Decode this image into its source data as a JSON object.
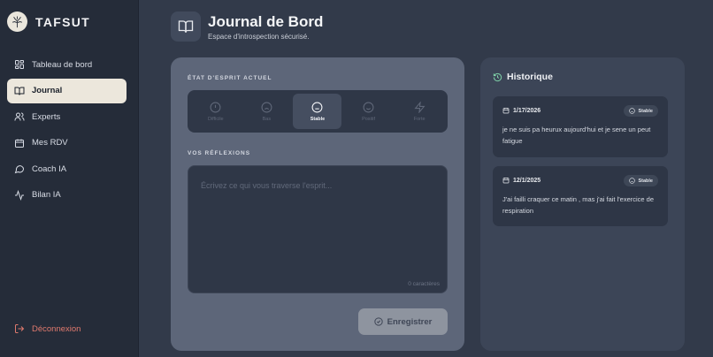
{
  "brand": {
    "name": "TAFSUT",
    "logo_icon": "tree-icon"
  },
  "sidebar": {
    "items": [
      {
        "label": "Tableau de bord",
        "icon": "dashboard-grid-icon",
        "active": false
      },
      {
        "label": "Journal",
        "icon": "book-icon",
        "active": true
      },
      {
        "label": "Experts",
        "icon": "users-icon",
        "active": false
      },
      {
        "label": "Mes RDV",
        "icon": "calendar-icon",
        "active": false
      },
      {
        "label": "Coach IA",
        "icon": "chat-bubble-icon",
        "active": false
      },
      {
        "label": "Bilan IA",
        "icon": "activity-icon",
        "active": false
      }
    ],
    "logout_label": "Déconnexion"
  },
  "header": {
    "title": "Journal de Bord",
    "subtitle": "Espace d'introspection sécurisé."
  },
  "mood_section": {
    "label": "ÉTAT D'ESPRIT ACTUEL",
    "options": [
      {
        "label": "Difficile",
        "icon": "alert-circle-icon",
        "active": false
      },
      {
        "label": "Bas",
        "icon": "frown-icon",
        "active": false
      },
      {
        "label": "Stable",
        "icon": "meh-icon",
        "active": true
      },
      {
        "label": "Positif",
        "icon": "smile-icon",
        "active": false
      },
      {
        "label": "Forte",
        "icon": "zap-icon",
        "active": false
      }
    ]
  },
  "reflection": {
    "label": "VOS RÉFLEXIONS",
    "placeholder": "Écrivez ce qui vous traverse l'esprit...",
    "value": "",
    "char_count": "0 caractères"
  },
  "save_button": {
    "label": "Enregistrer"
  },
  "history": {
    "title": "Historique",
    "entries": [
      {
        "date": "1/17/2026",
        "mood": "Stable",
        "text": "je ne suis pa heurux aujourd'hui et je sene un peut fatigue"
      },
      {
        "date": "12/1/2025",
        "mood": "Stable",
        "text": "J'ai failli craquer ce matin , mas j'ai fait l'exercice de respiration"
      }
    ]
  },
  "colors": {
    "background": "#323a4a",
    "sidebar": "#252c39",
    "active_nav": "#ece7dc",
    "logout": "#e07a6e",
    "main_panel": "#5d6679",
    "history_panel": "#3c4557",
    "accent_green": "#7fd1a8"
  }
}
